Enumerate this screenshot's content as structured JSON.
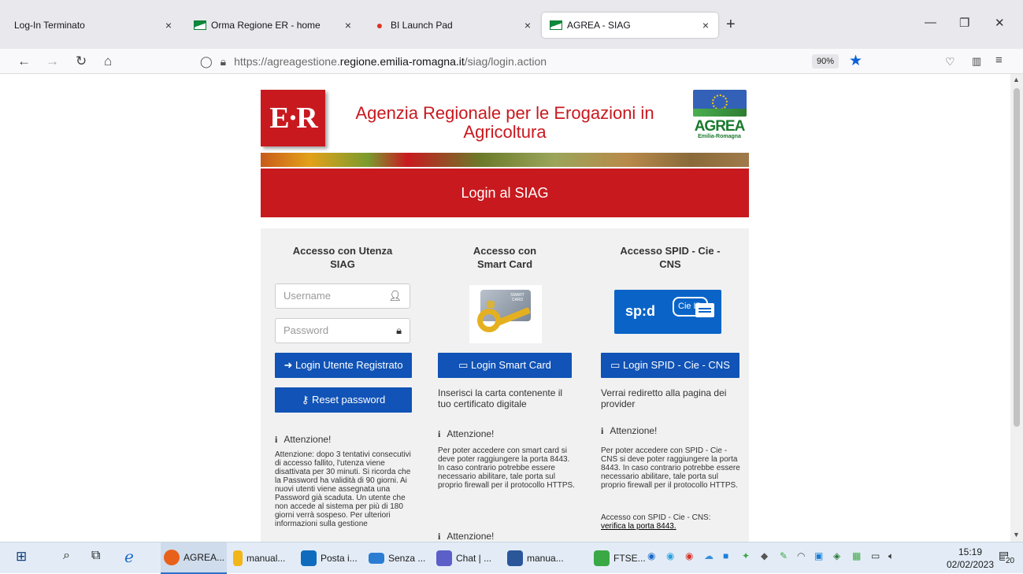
{
  "browser": {
    "tabs": [
      {
        "label": "Log-In Terminato",
        "active": false
      },
      {
        "label": "Orma Regione ER - home",
        "active": false
      },
      {
        "label": "BI Launch Pad",
        "active": false
      },
      {
        "label": "AGREA - SIAG",
        "active": true
      }
    ],
    "close_glyph": "×",
    "new_tab_glyph": "+",
    "url_prefix": "https://agreagestione.",
    "url_host": "regione.emilia-romagna.it",
    "url_path": "/siag/login.action",
    "zoom": "90%"
  },
  "header": {
    "er_logo": "E·R",
    "agency_name_line1": "Agenzia Regionale per le Erogazioni in",
    "agency_name_line2": "Agricoltura",
    "agrea_logo": "AGREA",
    "agrea_sub": "Emilia-Romagna"
  },
  "title": "Login al SIAG",
  "col_siag": {
    "heading": "Accesso con Utenza SIAG",
    "username_placeholder": "Username",
    "password_placeholder": "Password",
    "login_button": "Login Utente Registrato",
    "reset_button": "Reset password",
    "attention_heading": "Attenzione!",
    "attention_text": "Attenzione: dopo 3 tentativi consecutivi di accesso fallito, l'utenza viene disattivata per 30 minuti. Si ricorda che la Password ha validità di 90 giorni. Ai nuovi utenti viene assegnata una Password già scaduta. Un utente che non accede al sistema per più di 180 giorni verrà sospeso. Per ulteriori informazioni sulla gestione"
  },
  "col_smart": {
    "heading": "Accesso con Smart Card",
    "card_text": "SMART CARD",
    "login_button": "Login Smart Card",
    "description": "Inserisci la carta contenente il tuo certificato digitale",
    "attention_heading": "Attenzione!",
    "attention_text": "Per poter accedere con smart card si deve poter raggiungere la porta 8443. In caso contrario potrebbe essere necessario abilitare, tale porta sul proprio firewall per il protocollo HTTPS.",
    "attention_heading_2": "Attenzione!"
  },
  "col_spid": {
    "heading": "Accesso SPID - Cie - CNS",
    "spid_text": "sp:d",
    "cie_text": "Cie ID",
    "login_button": "Login SPID - Cie - CNS",
    "description": "Verrai rediretto alla pagina dei provider",
    "attention_heading": "Attenzione!",
    "attention_text": "Per poter accedere con SPID - Cie - CNS si deve poter raggiungere la porta 8443. In caso contrario potrebbe essere necessario abilitare, tale porta sul proprio firewall per il protocollo HTTPS.",
    "check_prefix": "Accesso con SPID - Cie - CNS:",
    "check_link": "verifica la porta 8443."
  },
  "taskbar": {
    "apps": [
      {
        "label": "AGREA...",
        "color": "#e8611a"
      },
      {
        "label": "manual...",
        "color": "#f2b619"
      },
      {
        "label": "Posta i...",
        "color": "#0f6cbd"
      },
      {
        "label": "Senza ...",
        "color": "#2b7cd3"
      },
      {
        "label": "Chat | ...",
        "color": "#5b5fc7"
      },
      {
        "label": "manua...",
        "color": "#2b579a"
      },
      {
        "label": "FTSE...",
        "color": "#3aa845"
      }
    ],
    "time": "15:19",
    "date": "02/02/2023",
    "notifications": "20"
  }
}
